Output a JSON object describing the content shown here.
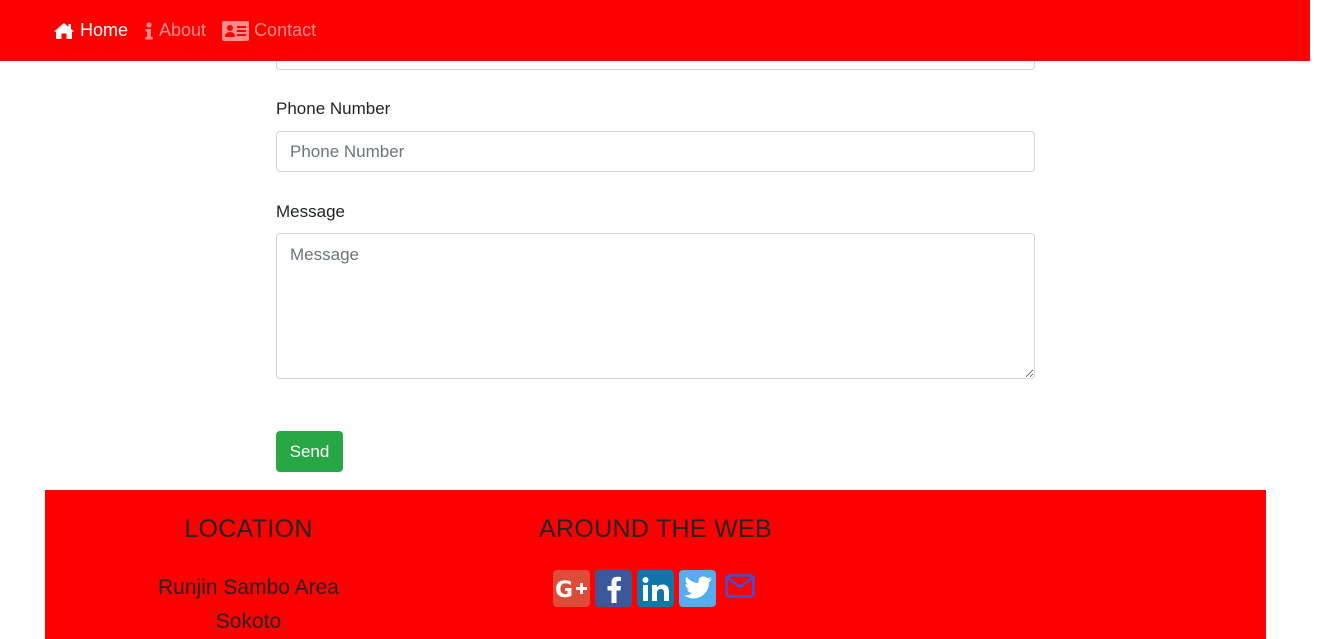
{
  "navbar": {
    "items": [
      {
        "label": "Home",
        "icon": "home-icon",
        "active": true
      },
      {
        "label": "About",
        "icon": "info-icon",
        "active": false
      },
      {
        "label": "Contact",
        "icon": "address-card-icon",
        "active": false
      }
    ],
    "background": "#ff0000"
  },
  "form": {
    "phone": {
      "label": "Phone Number",
      "placeholder": "Phone Number",
      "value": ""
    },
    "message": {
      "label": "Message",
      "placeholder": "Message",
      "value": ""
    },
    "send_label": "Send",
    "send_color": "#28a745"
  },
  "footer": {
    "location": {
      "heading": "LOCATION",
      "address_line1": "Runjin Sambo Area",
      "address_line2": "Sokoto"
    },
    "web": {
      "heading": "AROUND THE WEB",
      "social": [
        {
          "name": "google-plus",
          "icon": "google-plus-icon",
          "color": "#dd4b39"
        },
        {
          "name": "facebook",
          "icon": "facebook-icon",
          "color": "#3b5998"
        },
        {
          "name": "linkedin",
          "icon": "linkedin-icon",
          "color": "#0e76a8"
        },
        {
          "name": "twitter",
          "icon": "twitter-icon",
          "color": "#55acee"
        },
        {
          "name": "email",
          "icon": "envelope-icon",
          "color": "#3f51d6"
        }
      ]
    },
    "background": "#ff0000"
  }
}
